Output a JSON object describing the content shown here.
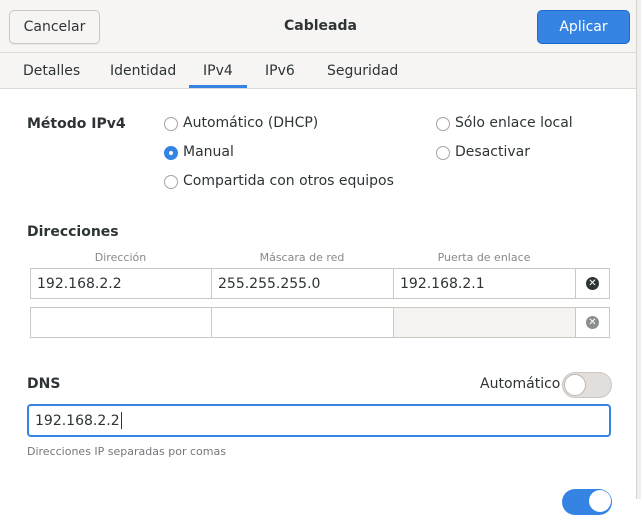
{
  "header": {
    "title": "Cableada",
    "cancel_label": "Cancelar",
    "apply_label": "Aplicar"
  },
  "tabs": [
    {
      "label": "Detalles",
      "active": false
    },
    {
      "label": "Identidad",
      "active": false
    },
    {
      "label": "IPv4",
      "active": true
    },
    {
      "label": "IPv6",
      "active": false
    },
    {
      "label": "Seguridad",
      "active": false
    }
  ],
  "method": {
    "label": "Método IPv4",
    "options": [
      {
        "label": "Automático (DHCP)",
        "checked": false
      },
      {
        "label": "Manual",
        "checked": true
      },
      {
        "label": "Compartida con otros equipos",
        "checked": false
      },
      {
        "label": "Sólo enlace local",
        "checked": false
      },
      {
        "label": "Desactivar",
        "checked": false
      }
    ]
  },
  "addresses": {
    "label": "Direcciones",
    "columns": [
      "Dirección",
      "Máscara de red",
      "Puerta de enlace"
    ],
    "rows": [
      [
        "192.168.2.2",
        "255.255.255.0",
        "192.168.2.1"
      ],
      [
        "",
        "",
        ""
      ]
    ]
  },
  "dns": {
    "label": "DNS",
    "auto_label": "Automático",
    "auto_enabled": false,
    "value": "192.168.2.2",
    "hint": "Direcciones IP separadas por comas"
  },
  "colors": {
    "accent": "#3584e4",
    "delete_active": "#2e3436",
    "delete_inactive": "#8b8e8f"
  }
}
